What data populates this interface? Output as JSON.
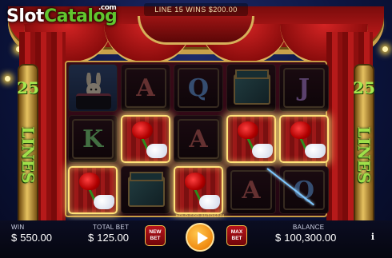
{
  "logo": {
    "slot": "Slot",
    "catalog": "Catalog",
    "com": ".com"
  },
  "banner": {
    "text": "LINE 15 WINS $200.00"
  },
  "side_label": {
    "number": "25",
    "word": "LINES"
  },
  "reels": [
    [
      "rabbit-hat",
      "K",
      "rose"
    ],
    [
      "A",
      "rose",
      "magic-box"
    ],
    [
      "Q",
      "A",
      "rose"
    ],
    [
      "magic-box",
      "rose",
      "A"
    ],
    [
      "J",
      "rose",
      "Q"
    ]
  ],
  "winning_cells": [
    [
      0,
      2
    ],
    [
      1,
      1
    ],
    [
      2,
      2
    ],
    [
      3,
      1
    ],
    [
      4,
      1
    ]
  ],
  "bottom_bar": {
    "win_label": "WIN",
    "win_currency": "$",
    "win_value": "550.00",
    "total_bet_label": "TOTAL BET",
    "total_bet_currency": "$",
    "total_bet_value": "125.00",
    "new_bet_label": "NEW BET",
    "hold_label": "HOLD FOR AUTOSPIN",
    "max_bet_label": "MAX BET",
    "balance_label": "BALANCE",
    "balance_currency": "$",
    "balance_value": "100,300.00",
    "info_label": "i"
  },
  "colors": {
    "accent_gold": "#d7b05a",
    "lines_green": "#9fe04a",
    "spin_orange": "#f08a10"
  }
}
